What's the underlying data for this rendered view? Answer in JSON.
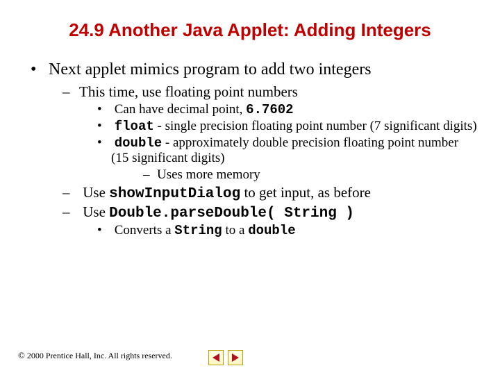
{
  "title": "24.9   Another Java Applet: Adding Integers",
  "b1": "Next applet mimics program to add two integers",
  "b1s1": "This time, use floating point numbers",
  "b1s1a_pre": "Can have decimal point, ",
  "b1s1a_code": "6.7602",
  "b1s1b_code": "float",
  "b1s1b_post": " - single precision floating point number (7 significant digits)",
  "b1s1c_code": "double",
  "b1s1c_post": " - approximately double precision floating point number (15 significant digits)",
  "b1s1c_sub": "Uses more memory",
  "b1s2_pre": "Use ",
  "b1s2_code": "showInputDialog",
  "b1s2_post": " to get input, as before",
  "b1s3_pre": "Use ",
  "b1s3_code": "Double.parseDouble( String )",
  "b1s3a_pre": "Converts a ",
  "b1s3a_code1": "String",
  "b1s3a_mid": " to a ",
  "b1s3a_code2": "double",
  "copyright": " 2000 Prentice Hall, Inc.  All rights reserved."
}
